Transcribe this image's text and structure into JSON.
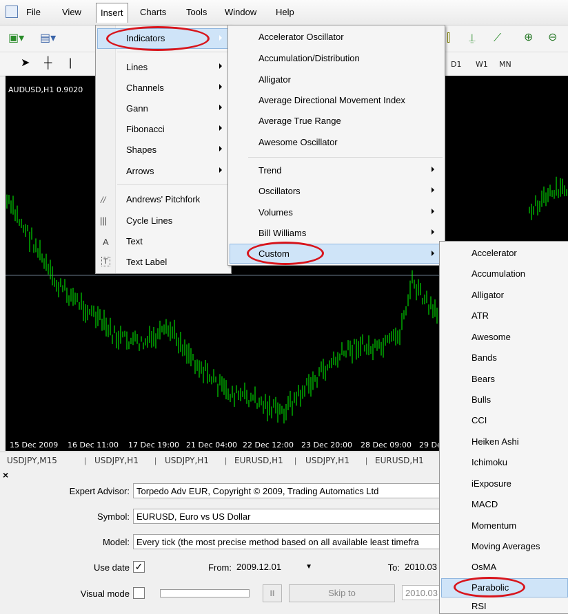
{
  "menubar": {
    "items": [
      "File",
      "View",
      "Insert",
      "Charts",
      "Tools",
      "Window",
      "Help"
    ]
  },
  "toolbar2": {
    "timeframes": [
      "D1",
      "W1",
      "MN"
    ]
  },
  "chart": {
    "title": "AUDUSD,H1  0.9020",
    "dates": [
      "15 Dec 2009",
      "16 Dec 11:00",
      "17 Dec 19:00",
      "21 Dec 04:00",
      "22 Dec 12:00",
      "23 Dec 20:00",
      "28 Dec 09:00",
      "29 De"
    ],
    "colors": {
      "background": "#000000",
      "bars": "#00ff00"
    }
  },
  "chart_tabs": [
    "USDJPY,M15",
    "USDJPY,H1",
    "USDJPY,H1",
    "EURUSD,H1",
    "USDJPY,H1",
    "EURUSD,H1"
  ],
  "tester": {
    "close": "×",
    "expert_advisor_label": "Expert Advisor:",
    "expert_advisor_value": "Torpedo Adv EUR, Copyright © 2009, Trading Automatics Ltd",
    "symbol_label": "Symbol:",
    "symbol_value": "EURUSD, Euro vs US Dollar",
    "model_label": "Model:",
    "model_value": "Every tick (the most precise method based on all available least timefra",
    "use_date_label": "Use date",
    "use_date_checked": "✓",
    "from_label": "From:",
    "from_value": "2009.12.01",
    "to_label": "To:",
    "to_value": "2010.03",
    "visual_mode_label": "Visual mode",
    "pause_label": "II",
    "skip_to_label": "Skip to",
    "skip_to_value": "2010.03"
  },
  "insert_menu": {
    "indicators": "Indicators",
    "items": [
      "Lines",
      "Channels",
      "Gann",
      "Fibonacci",
      "Shapes",
      "Arrows"
    ],
    "tools": [
      "Andrews' Pitchfork",
      "Cycle Lines",
      "Text",
      "Text Label"
    ],
    "tool_icons": [
      "//",
      "|||",
      "A",
      "T"
    ]
  },
  "indicators_menu": {
    "items": [
      "Accelerator Oscillator",
      "Accumulation/Distribution",
      "Alligator",
      "Average Directional Movement Index",
      "Average True Range",
      "Awesome Oscillator"
    ],
    "groups": [
      "Trend",
      "Oscillators",
      "Volumes",
      "Bill Williams",
      "Custom"
    ]
  },
  "custom_menu": {
    "items": [
      "Accelerator",
      "Accumulation",
      "Alligator",
      "ATR",
      "Awesome",
      "Bands",
      "Bears",
      "Bulls",
      "CCI",
      "Heiken Ashi",
      "Ichimoku",
      "iExposure",
      "MACD",
      "Momentum",
      "Moving Averages",
      "OsMA",
      "Parabolic",
      "RSI"
    ],
    "highlighted": "Parabolic"
  }
}
